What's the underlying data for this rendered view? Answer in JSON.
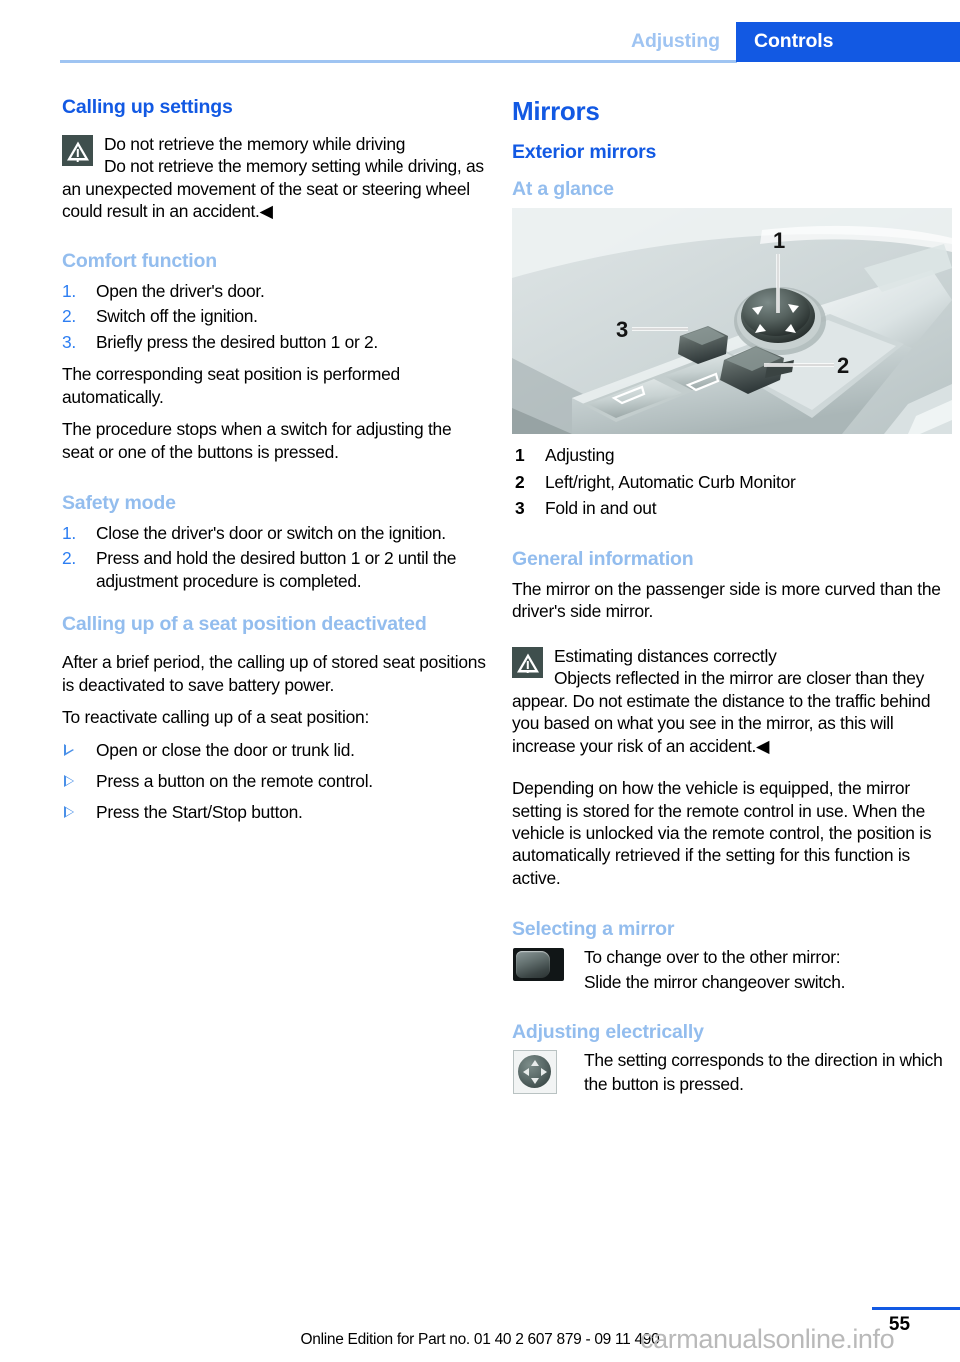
{
  "header": {
    "section": "Adjusting",
    "chapter_tab": "Controls"
  },
  "left_column": {
    "h2_calling_up_settings": "Calling up settings",
    "warning_1": {
      "icon": "warning-triangle-icon",
      "title": "Do not retrieve the memory while driving",
      "body": "Do not retrieve the memory setting while driving, as an unexpected movement of the seat or steering wheel could result in an accident.◀"
    },
    "h3_comfort_function": "Comfort function",
    "comfort_steps": [
      {
        "num": "1.",
        "text": "Open the driver's door."
      },
      {
        "num": "2.",
        "text": "Switch off the ignition."
      },
      {
        "num": "3.",
        "text": "Briefly press the desired button 1 or 2."
      }
    ],
    "comfort_p1": "The corresponding seat position is performed automatically.",
    "comfort_p2": "The procedure stops when a switch for adjusting the seat or one of the buttons is pressed.",
    "h3_safety_mode": "Safety mode",
    "safety_steps": [
      {
        "num": "1.",
        "text": "Close the driver's door or switch on the ignition."
      },
      {
        "num": "2.",
        "text": "Press and hold the desired button 1 or 2 until the adjustment procedure is completed."
      }
    ],
    "h3_calling_up_deactivated": "Calling up of a seat position deactivated",
    "deact_p1": "After a brief period, the calling up of stored seat positions is deactivated to save battery power.",
    "deact_p2": "To reactivate calling up of a seat position:",
    "deact_bullets": [
      "Open or close the door or trunk lid.",
      "Press a button on the remote control.",
      "Press the Start/Stop button."
    ]
  },
  "right_column": {
    "h1_mirrors": "Mirrors",
    "h2_exterior_mirrors": "Exterior mirrors",
    "h3_at_a_glance": "At a glance",
    "figure": {
      "alt_name": "door-panel-mirror-controls-illustration",
      "callouts": [
        "1",
        "2",
        "3"
      ]
    },
    "legend": [
      {
        "num": "1",
        "text": "Adjusting"
      },
      {
        "num": "2",
        "text": "Left/right, Automatic Curb Monitor"
      },
      {
        "num": "3",
        "text": "Fold in and out"
      }
    ],
    "h3_general_information": "General information",
    "general_p1": "The mirror on the passenger side is more curved than the driver's side mirror.",
    "warning_2": {
      "icon": "warning-triangle-icon",
      "title": "Estimating distances correctly",
      "body": "Objects reflected in the mirror are closer than they appear. Do not estimate the distance to the traffic behind you based on what you see in the mirror, as this will increase your risk of an accident.◀"
    },
    "general_p2": "Depending on how the vehicle is equipped, the mirror setting is stored for the remote control in use. When the vehicle is unlocked via the remote control, the position is automatically retrieved if the setting for this function is active.",
    "h3_selecting_a_mirror": "Selecting a mirror",
    "selecting": {
      "icon": "rocker-switch-icon",
      "line1": "To change over to the other mirror:",
      "line2": "Slide the mirror changeover switch."
    },
    "h3_adjusting_electrically": "Adjusting electrically",
    "adjusting": {
      "icon": "joystick-button-icon",
      "text": "The setting corresponds to the direction in which the button is pressed."
    }
  },
  "footer": {
    "edition_text": "Online Edition for Part no. 01 40 2 607 879 - 09 11 490",
    "page_number": "55",
    "watermark": "carmanualsonline.info"
  },
  "colors": {
    "brand_blue": "#1259e3",
    "light_blue": "#93bdee",
    "rule_blue": "#9fc4f2",
    "list_num_blue": "#2d7ef2",
    "warn_icon_bg": "#3f4f4d"
  }
}
